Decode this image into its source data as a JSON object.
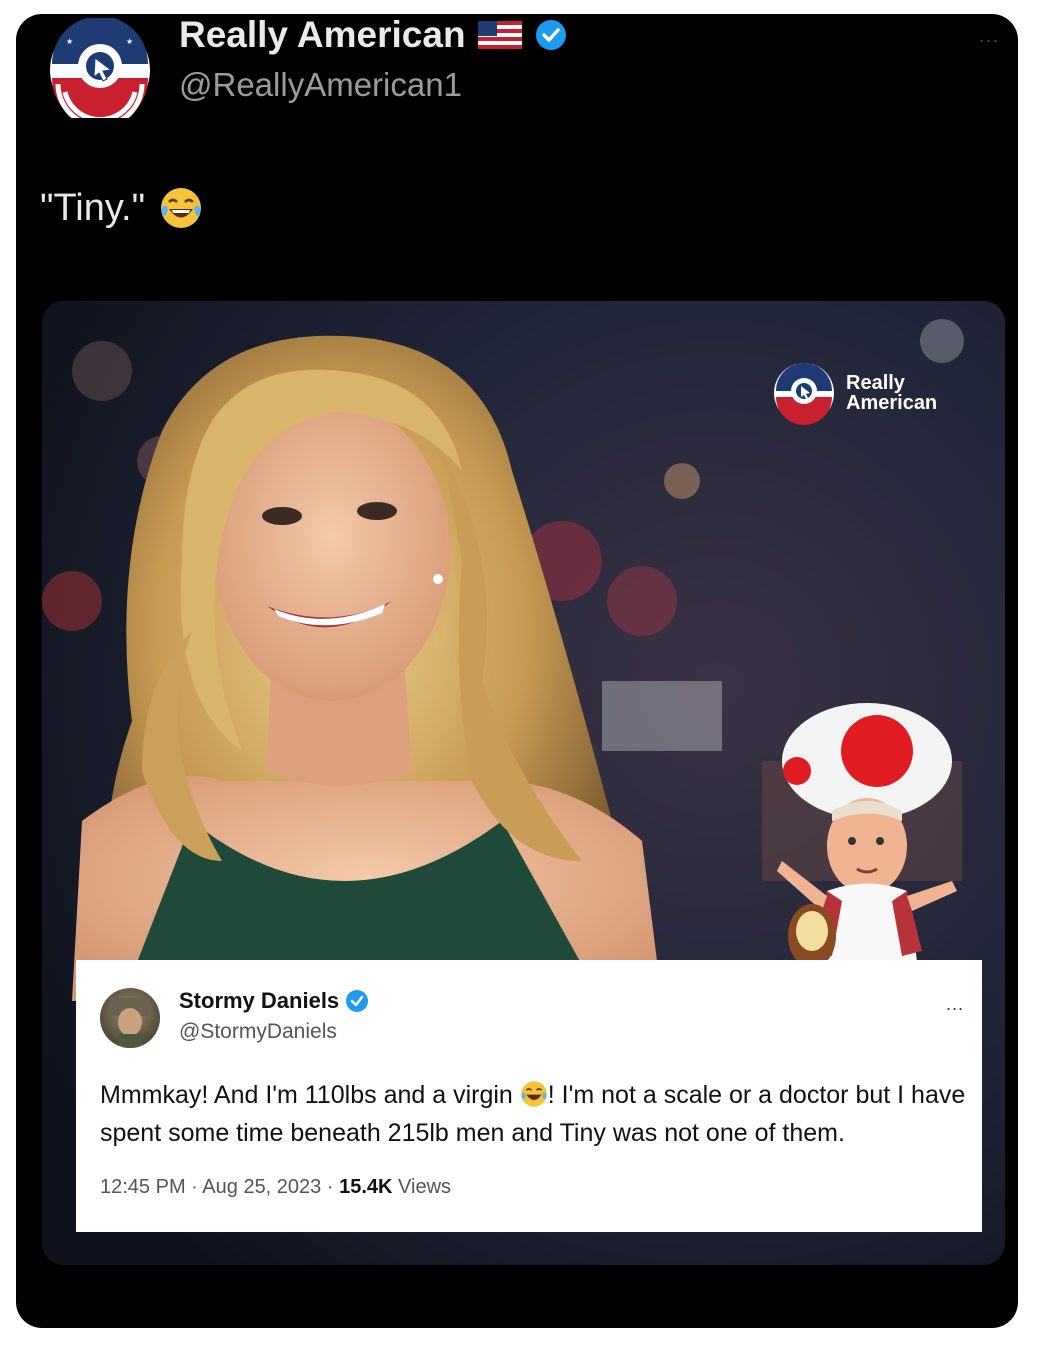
{
  "post": {
    "display_name": "Really American",
    "handle": "@ReallyAmerican1",
    "text": "\"Tiny.\"",
    "more": "..."
  },
  "media": {
    "brand_logo_text": "Really American"
  },
  "embedded_tweet": {
    "name": "Stormy Daniels",
    "handle": "@StormyDaniels",
    "more": "...",
    "text_part1": "Mmmkay! And I'm 110lbs and a virgin ",
    "text_part2": "! I'm not a scale or a doctor but I have spent some time beneath 215lb men and Tiny was not one of them.",
    "time": "12:45 PM",
    "date": "Aug 25, 2023",
    "views_count": "15.4K",
    "views_label": "Views",
    "separator": "·"
  },
  "colors": {
    "background": "#000000",
    "verified": "#1d9bf0",
    "brand_red": "#c8202f",
    "brand_blue": "#1f3b73"
  },
  "icons": [
    "avatar-logo-icon",
    "us-flag-icon",
    "verified-badge-icon",
    "laughing-crying-emoji-icon",
    "more-options-icon"
  ]
}
